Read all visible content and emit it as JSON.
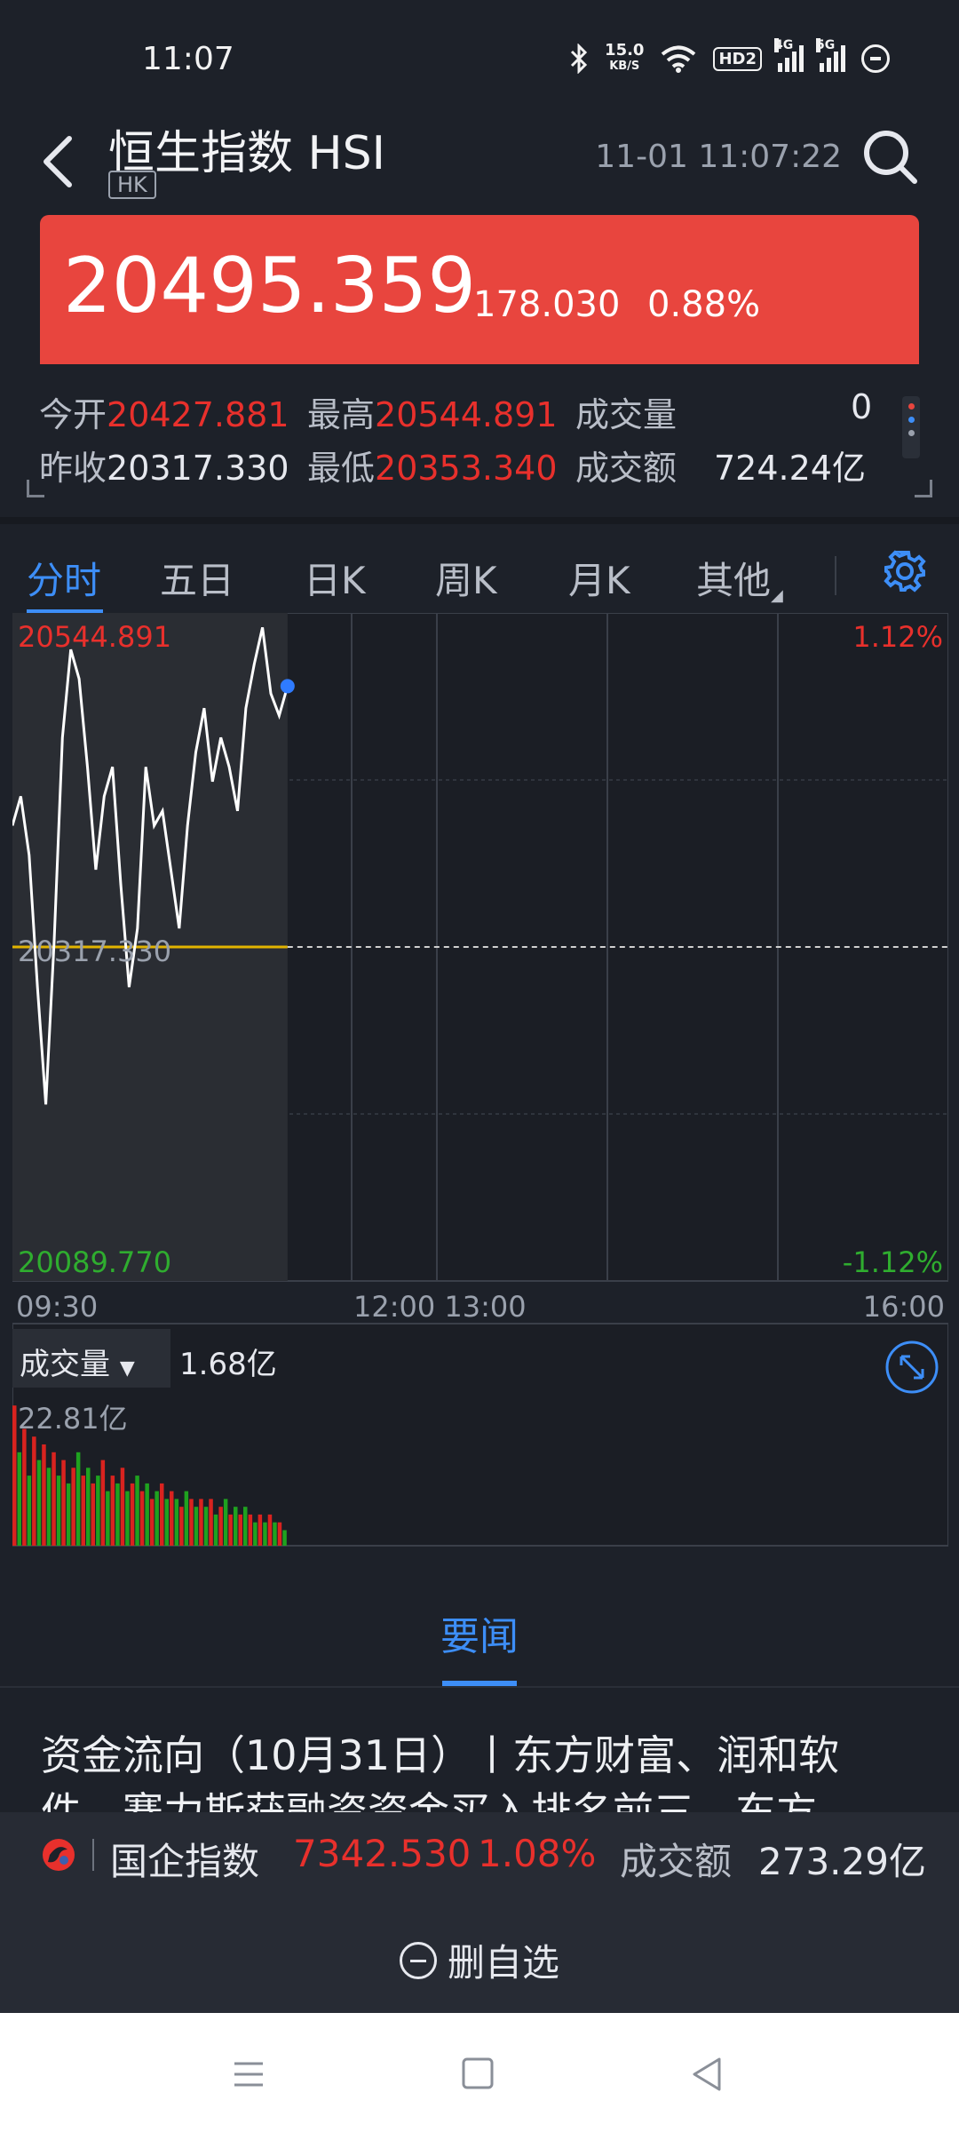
{
  "status_bar": {
    "time": "11:07",
    "net_speed_top": "15.0",
    "net_speed_unit": "KB/S",
    "hd_label": "HD2",
    "sig1_tag": "4G",
    "sig2_tag": "5G",
    "icons": [
      "bluetooth-icon",
      "wifi-icon",
      "signal-icon",
      "signal-icon",
      "data-saver-icon"
    ]
  },
  "header": {
    "title": "恒生指数 HSI",
    "market_tag": "HK",
    "datetime": "11-01 11:07:22"
  },
  "quote": {
    "price": "20495.359",
    "change": "178.030",
    "change_pct": "0.88%",
    "up_color": "#e8453e"
  },
  "stats": {
    "open_label": "今开",
    "open": "20427.881",
    "high_label": "最高",
    "high": "20544.891",
    "volume_label": "成交量",
    "volume": "0",
    "prev_close_label": "昨收",
    "prev_close": "20317.330",
    "low_label": "最低",
    "low": "20353.340",
    "turnover_label": "成交额",
    "turnover": "724.24亿"
  },
  "tabs": [
    {
      "label": "分时",
      "active": true
    },
    {
      "label": "五日"
    },
    {
      "label": "日K"
    },
    {
      "label": "周K"
    },
    {
      "label": "月K"
    },
    {
      "label": "其他"
    }
  ],
  "chart": {
    "y_high": "20544.891",
    "y_mid": "20317.330",
    "y_low": "20089.770",
    "pct_high": "1.12%",
    "pct_low": "-1.12%",
    "time_labels": [
      "09:30",
      "12:00 13:00",
      "16:00"
    ],
    "volume_label": "成交量",
    "volume_value": "1.68亿",
    "volume_max": "22.81亿"
  },
  "chart_data": {
    "type": "line",
    "title": "",
    "xlabel": "",
    "ylabel": "",
    "ylim": [
      20089.77,
      20544.891
    ],
    "x": [
      "09:30",
      "09:33",
      "09:36",
      "09:39",
      "09:42",
      "09:45",
      "09:48",
      "09:51",
      "09:54",
      "09:57",
      "10:00",
      "10:03",
      "10:06",
      "10:09",
      "10:12",
      "10:15",
      "10:18",
      "10:21",
      "10:24",
      "10:27",
      "10:30",
      "10:33",
      "10:36",
      "10:39",
      "10:42",
      "10:45",
      "10:48",
      "10:51",
      "10:54",
      "10:57",
      "11:00",
      "11:03",
      "11:06",
      "11:07"
    ],
    "series": [
      {
        "values": [
          20400,
          20420,
          20380,
          20290,
          20210,
          20320,
          20460,
          20520,
          20500,
          20440,
          20370,
          20420,
          20440,
          20360,
          20290,
          20330,
          20440,
          20400,
          20410,
          20370,
          20330,
          20400,
          20450,
          20480,
          20430,
          20460,
          20440,
          20410,
          20480,
          20510,
          20535,
          20490,
          20475,
          20495
        ]
      }
    ],
    "reference_line": 20317.33,
    "volume": {
      "type": "bar",
      "ylim": [
        0,
        22.81
      ],
      "values": [
        18,
        12,
        15,
        9,
        14,
        11,
        13,
        10,
        12,
        9,
        11,
        8,
        10,
        12,
        9,
        10,
        8,
        9,
        11,
        7,
        9,
        8,
        10,
        7,
        8,
        9,
        7,
        8,
        6,
        7,
        8,
        6,
        7,
        6,
        5,
        7,
        6,
        5,
        6,
        5,
        6,
        4,
        5,
        6,
        4,
        5,
        4,
        5,
        4,
        3,
        4,
        3,
        4,
        3,
        3,
        2
      ],
      "colors_pattern": [
        "red",
        "green"
      ]
    }
  },
  "news": {
    "tab_label": "要闻",
    "headline": "资金流向（10月31日）丨东方财富、润和软件、赛力斯获融资资金买入排名前三，东方"
  },
  "ticker": {
    "name": "国企指数",
    "value": "7342.530",
    "pct": "1.08%",
    "turnover_label": "成交额",
    "turnover": "273.29亿"
  },
  "actions": {
    "delete_label": "删自选"
  }
}
